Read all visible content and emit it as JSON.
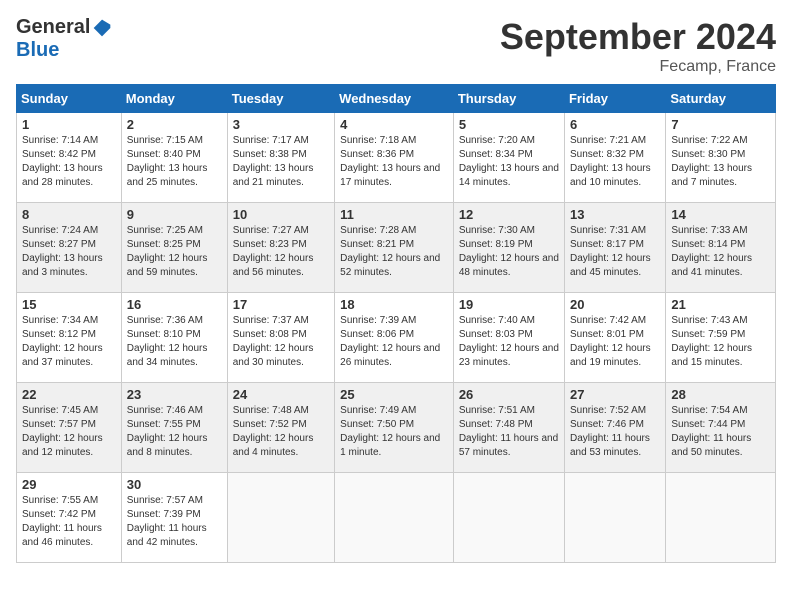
{
  "logo": {
    "general": "General",
    "blue": "Blue"
  },
  "title": "September 2024",
  "location": "Fecamp, France",
  "headers": [
    "Sunday",
    "Monday",
    "Tuesday",
    "Wednesday",
    "Thursday",
    "Friday",
    "Saturday"
  ],
  "weeks": [
    [
      {
        "day": "1",
        "sunrise": "Sunrise: 7:14 AM",
        "sunset": "Sunset: 8:42 PM",
        "daylight": "Daylight: 13 hours and 28 minutes."
      },
      {
        "day": "2",
        "sunrise": "Sunrise: 7:15 AM",
        "sunset": "Sunset: 8:40 PM",
        "daylight": "Daylight: 13 hours and 25 minutes."
      },
      {
        "day": "3",
        "sunrise": "Sunrise: 7:17 AM",
        "sunset": "Sunset: 8:38 PM",
        "daylight": "Daylight: 13 hours and 21 minutes."
      },
      {
        "day": "4",
        "sunrise": "Sunrise: 7:18 AM",
        "sunset": "Sunset: 8:36 PM",
        "daylight": "Daylight: 13 hours and 17 minutes."
      },
      {
        "day": "5",
        "sunrise": "Sunrise: 7:20 AM",
        "sunset": "Sunset: 8:34 PM",
        "daylight": "Daylight: 13 hours and 14 minutes."
      },
      {
        "day": "6",
        "sunrise": "Sunrise: 7:21 AM",
        "sunset": "Sunset: 8:32 PM",
        "daylight": "Daylight: 13 hours and 10 minutes."
      },
      {
        "day": "7",
        "sunrise": "Sunrise: 7:22 AM",
        "sunset": "Sunset: 8:30 PM",
        "daylight": "Daylight: 13 hours and 7 minutes."
      }
    ],
    [
      {
        "day": "8",
        "sunrise": "Sunrise: 7:24 AM",
        "sunset": "Sunset: 8:27 PM",
        "daylight": "Daylight: 13 hours and 3 minutes."
      },
      {
        "day": "9",
        "sunrise": "Sunrise: 7:25 AM",
        "sunset": "Sunset: 8:25 PM",
        "daylight": "Daylight: 12 hours and 59 minutes."
      },
      {
        "day": "10",
        "sunrise": "Sunrise: 7:27 AM",
        "sunset": "Sunset: 8:23 PM",
        "daylight": "Daylight: 12 hours and 56 minutes."
      },
      {
        "day": "11",
        "sunrise": "Sunrise: 7:28 AM",
        "sunset": "Sunset: 8:21 PM",
        "daylight": "Daylight: 12 hours and 52 minutes."
      },
      {
        "day": "12",
        "sunrise": "Sunrise: 7:30 AM",
        "sunset": "Sunset: 8:19 PM",
        "daylight": "Daylight: 12 hours and 48 minutes."
      },
      {
        "day": "13",
        "sunrise": "Sunrise: 7:31 AM",
        "sunset": "Sunset: 8:17 PM",
        "daylight": "Daylight: 12 hours and 45 minutes."
      },
      {
        "day": "14",
        "sunrise": "Sunrise: 7:33 AM",
        "sunset": "Sunset: 8:14 PM",
        "daylight": "Daylight: 12 hours and 41 minutes."
      }
    ],
    [
      {
        "day": "15",
        "sunrise": "Sunrise: 7:34 AM",
        "sunset": "Sunset: 8:12 PM",
        "daylight": "Daylight: 12 hours and 37 minutes."
      },
      {
        "day": "16",
        "sunrise": "Sunrise: 7:36 AM",
        "sunset": "Sunset: 8:10 PM",
        "daylight": "Daylight: 12 hours and 34 minutes."
      },
      {
        "day": "17",
        "sunrise": "Sunrise: 7:37 AM",
        "sunset": "Sunset: 8:08 PM",
        "daylight": "Daylight: 12 hours and 30 minutes."
      },
      {
        "day": "18",
        "sunrise": "Sunrise: 7:39 AM",
        "sunset": "Sunset: 8:06 PM",
        "daylight": "Daylight: 12 hours and 26 minutes."
      },
      {
        "day": "19",
        "sunrise": "Sunrise: 7:40 AM",
        "sunset": "Sunset: 8:03 PM",
        "daylight": "Daylight: 12 hours and 23 minutes."
      },
      {
        "day": "20",
        "sunrise": "Sunrise: 7:42 AM",
        "sunset": "Sunset: 8:01 PM",
        "daylight": "Daylight: 12 hours and 19 minutes."
      },
      {
        "day": "21",
        "sunrise": "Sunrise: 7:43 AM",
        "sunset": "Sunset: 7:59 PM",
        "daylight": "Daylight: 12 hours and 15 minutes."
      }
    ],
    [
      {
        "day": "22",
        "sunrise": "Sunrise: 7:45 AM",
        "sunset": "Sunset: 7:57 PM",
        "daylight": "Daylight: 12 hours and 12 minutes."
      },
      {
        "day": "23",
        "sunrise": "Sunrise: 7:46 AM",
        "sunset": "Sunset: 7:55 PM",
        "daylight": "Daylight: 12 hours and 8 minutes."
      },
      {
        "day": "24",
        "sunrise": "Sunrise: 7:48 AM",
        "sunset": "Sunset: 7:52 PM",
        "daylight": "Daylight: 12 hours and 4 minutes."
      },
      {
        "day": "25",
        "sunrise": "Sunrise: 7:49 AM",
        "sunset": "Sunset: 7:50 PM",
        "daylight": "Daylight: 12 hours and 1 minute."
      },
      {
        "day": "26",
        "sunrise": "Sunrise: 7:51 AM",
        "sunset": "Sunset: 7:48 PM",
        "daylight": "Daylight: 11 hours and 57 minutes."
      },
      {
        "day": "27",
        "sunrise": "Sunrise: 7:52 AM",
        "sunset": "Sunset: 7:46 PM",
        "daylight": "Daylight: 11 hours and 53 minutes."
      },
      {
        "day": "28",
        "sunrise": "Sunrise: 7:54 AM",
        "sunset": "Sunset: 7:44 PM",
        "daylight": "Daylight: 11 hours and 50 minutes."
      }
    ],
    [
      {
        "day": "29",
        "sunrise": "Sunrise: 7:55 AM",
        "sunset": "Sunset: 7:42 PM",
        "daylight": "Daylight: 11 hours and 46 minutes."
      },
      {
        "day": "30",
        "sunrise": "Sunrise: 7:57 AM",
        "sunset": "Sunset: 7:39 PM",
        "daylight": "Daylight: 11 hours and 42 minutes."
      },
      null,
      null,
      null,
      null,
      null
    ]
  ]
}
